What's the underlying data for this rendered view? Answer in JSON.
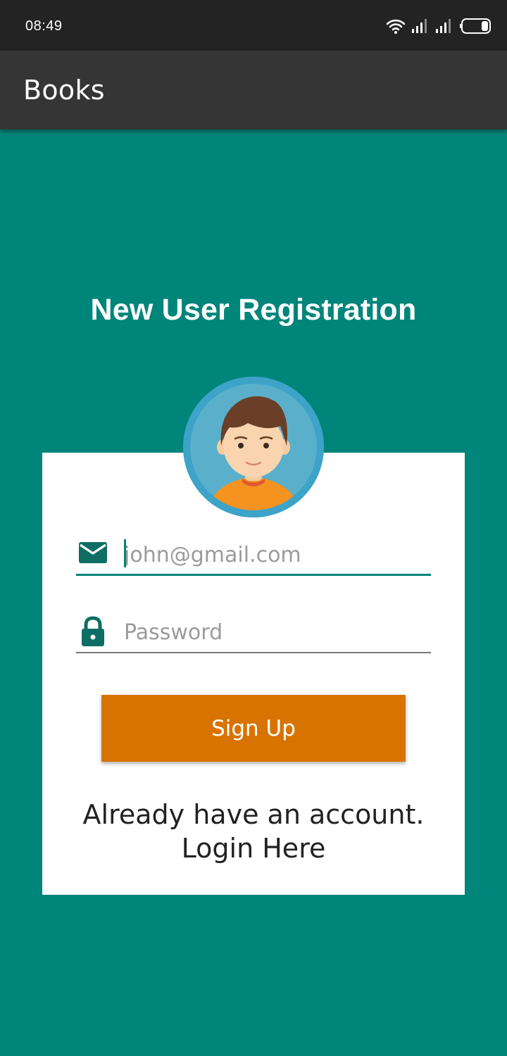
{
  "status_bar": {
    "time": "08:49",
    "icons": [
      "wifi-icon",
      "signal-icon",
      "signal-icon",
      "battery-icon"
    ]
  },
  "app_bar": {
    "title": "Books"
  },
  "main": {
    "title": "New User Registration",
    "avatar_icon": "user-avatar",
    "email": {
      "icon": "mail-icon",
      "placeholder": "john@gmail.com",
      "value": ""
    },
    "password": {
      "icon": "lock-icon",
      "placeholder": "Password",
      "value": ""
    },
    "signup_label": "Sign Up",
    "login_line1": "Already have an account.",
    "login_line2": "Login Here"
  },
  "colors": {
    "background": "#00857A",
    "accent": "#00857A",
    "button": "#D97300",
    "app_bar": "#353535",
    "status_bar": "#232323"
  }
}
